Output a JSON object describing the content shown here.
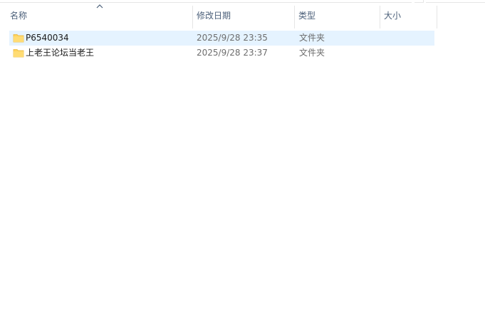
{
  "columns": {
    "name": "名称",
    "modified": "修改日期",
    "type": "类型",
    "size": "大小"
  },
  "sort": {
    "column": "name",
    "direction": "ascending",
    "icon": "chevron-up-icon"
  },
  "colors": {
    "selected_row": "#e5f3ff",
    "header_text": "#4c607a",
    "folder": "#ffd35b"
  },
  "files": [
    {
      "name": "P6540034",
      "modified": "2025/9/28 23:35",
      "type": "文件夹",
      "size": "",
      "icon": "folder-icon",
      "selected": true
    },
    {
      "name": "上老王论坛当老王",
      "modified": "2025/9/28 23:37",
      "type": "文件夹",
      "size": "",
      "icon": "folder-icon",
      "selected": false
    }
  ]
}
